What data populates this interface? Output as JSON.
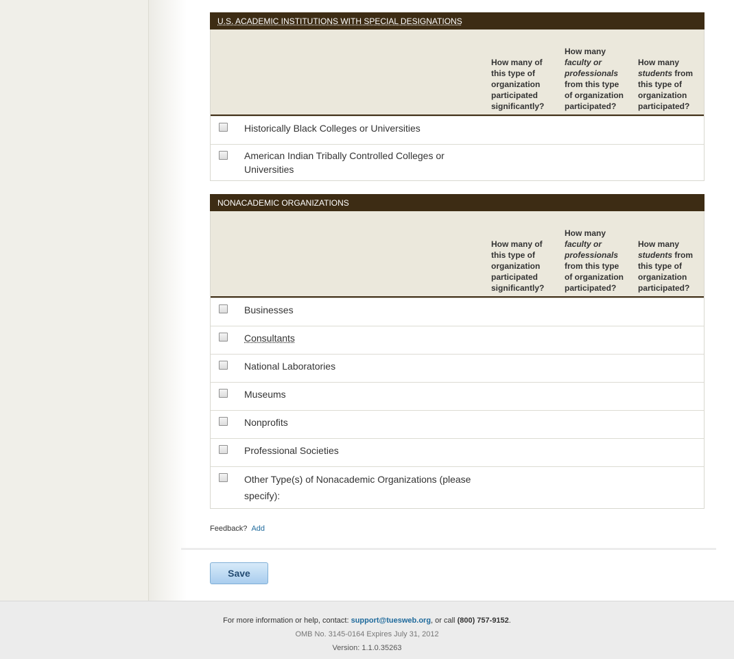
{
  "columns": {
    "col1": "How many of this type of organization participated significantly?",
    "col2_a": "How many ",
    "col2_b": "faculty or professionals",
    "col2_c": " from this type of organization participated?",
    "col3_a": "How many ",
    "col3_b": "students",
    "col3_c": " from this type of organization participated?"
  },
  "academic": {
    "title": "U.S. ACADEMIC INSTITUTIONS WITH SPECIAL DESIGNATIONS",
    "rows": [
      "Historically Black Colleges or Universities",
      "American Indian Tribally Controlled Colleges or Universities"
    ]
  },
  "nonacademic": {
    "title": "NONACADEMIC ORGANIZATIONS",
    "rows": [
      "Businesses",
      "Consultants",
      "National Laboratories",
      "Museums",
      "Nonprofits",
      "Professional Societies",
      "Other Type(s) of Nonacademic Organizations (please specify):"
    ]
  },
  "feedback": {
    "label": "Feedback?",
    "link": "Add"
  },
  "save_label": "Save",
  "footer": {
    "prefix": "For more information or help, contact: ",
    "email": "support@tuesweb.org",
    "middle": ", or call ",
    "phone": "(800) 757-9152",
    "suffix": ".",
    "omb": "OMB No. 3145-0164 Expires July 31, 2012",
    "version": "Version: 1.1.0.35263"
  },
  "colors": {
    "header_bg": "#3d2c14",
    "col_head_bg": "#ebe8dc",
    "link": "#1f6a9c"
  }
}
